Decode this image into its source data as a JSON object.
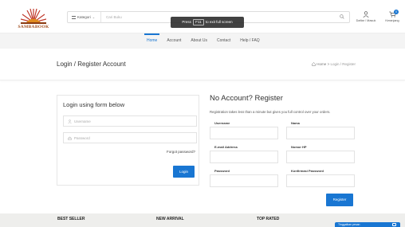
{
  "brand": {
    "name": "SAMBABOOK"
  },
  "search": {
    "category_label": "Kategori",
    "placeholder": "Cari Buku"
  },
  "fullscreen_notice": {
    "prefix": "Press",
    "key": "F11",
    "suffix": "to exit full screen"
  },
  "account": {
    "label": "Daftar / Masuk"
  },
  "cart": {
    "label": "Keranjang",
    "count": "0"
  },
  "nav": {
    "items": [
      "Home",
      "Account",
      "About Us",
      "Contact",
      "Help / FAQ"
    ],
    "active_index": 0
  },
  "page_header": {
    "title": "Login / Register Account",
    "breadcrumb_home": "Home",
    "breadcrumb_sep": ">",
    "breadcrumb_current": "Login / Register"
  },
  "login": {
    "title": "Login using form below",
    "username_placeholder": "Username",
    "password_placeholder": "Password",
    "forgot_label": "Forgot password?",
    "submit_label": "Login"
  },
  "register": {
    "title": "No Account? Register",
    "subtitle": "Registration takes less than a minute but gives you full control over your orders.",
    "fields": {
      "username": "Username",
      "nama": "Nama",
      "email": "E-mail Address",
      "nomor_hp": "Nomor HP",
      "password": "Password",
      "konfirmasi": "Konfirmasi Password"
    },
    "submit_label": "Register"
  },
  "footer": {
    "best_seller": "BEST SELLER",
    "new_arrival": "NEW ARRIVAL",
    "top_rated": "TOP RATED"
  },
  "chat": {
    "label": "Tinggalkan pesan"
  },
  "colors": {
    "accent": "#1976d2",
    "brand": "#a04a1a"
  },
  "icons": [
    "menu-icon",
    "chevron-down-icon",
    "search-icon",
    "user-icon",
    "cart-icon",
    "home-icon",
    "lock-icon",
    "chat-icon"
  ]
}
